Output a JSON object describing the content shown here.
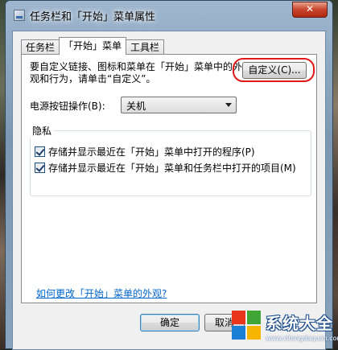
{
  "window": {
    "title": "任务栏和「开始」菜单属性",
    "close_label": "✕"
  },
  "tabs": [
    {
      "label": "任务栏",
      "active": false
    },
    {
      "label": "「开始」菜单",
      "active": true
    },
    {
      "label": "工具栏",
      "active": false
    }
  ],
  "start_menu": {
    "description": "要自定义链接、图标和菜单在「开始」菜单中的外观和行为，请单击“自定义”。",
    "customize_button": "自定义(C)...",
    "power_label": "电源按钮操作(B):",
    "power_value": "关机",
    "privacy": {
      "caption": "隐私",
      "items": [
        {
          "label": "存储并显示最近在「开始」菜单中打开的程序(P)",
          "checked": true
        },
        {
          "label": "存储并显示最近在「开始」菜单和任务栏中打开的项目(M)",
          "checked": true
        }
      ]
    },
    "help_link": "如何更改「开始」菜单的外观?"
  },
  "buttons": {
    "ok": "确定",
    "cancel": "取消"
  },
  "watermark": {
    "text": "系统大全",
    "sub": "www.xitongdaquan.com",
    "colors": [
      "#e8351c",
      "#3fa535",
      "#1b7fd6",
      "#f7b500"
    ]
  },
  "colors": {
    "highlight_ring": "#e01818",
    "link": "#0066cc"
  }
}
